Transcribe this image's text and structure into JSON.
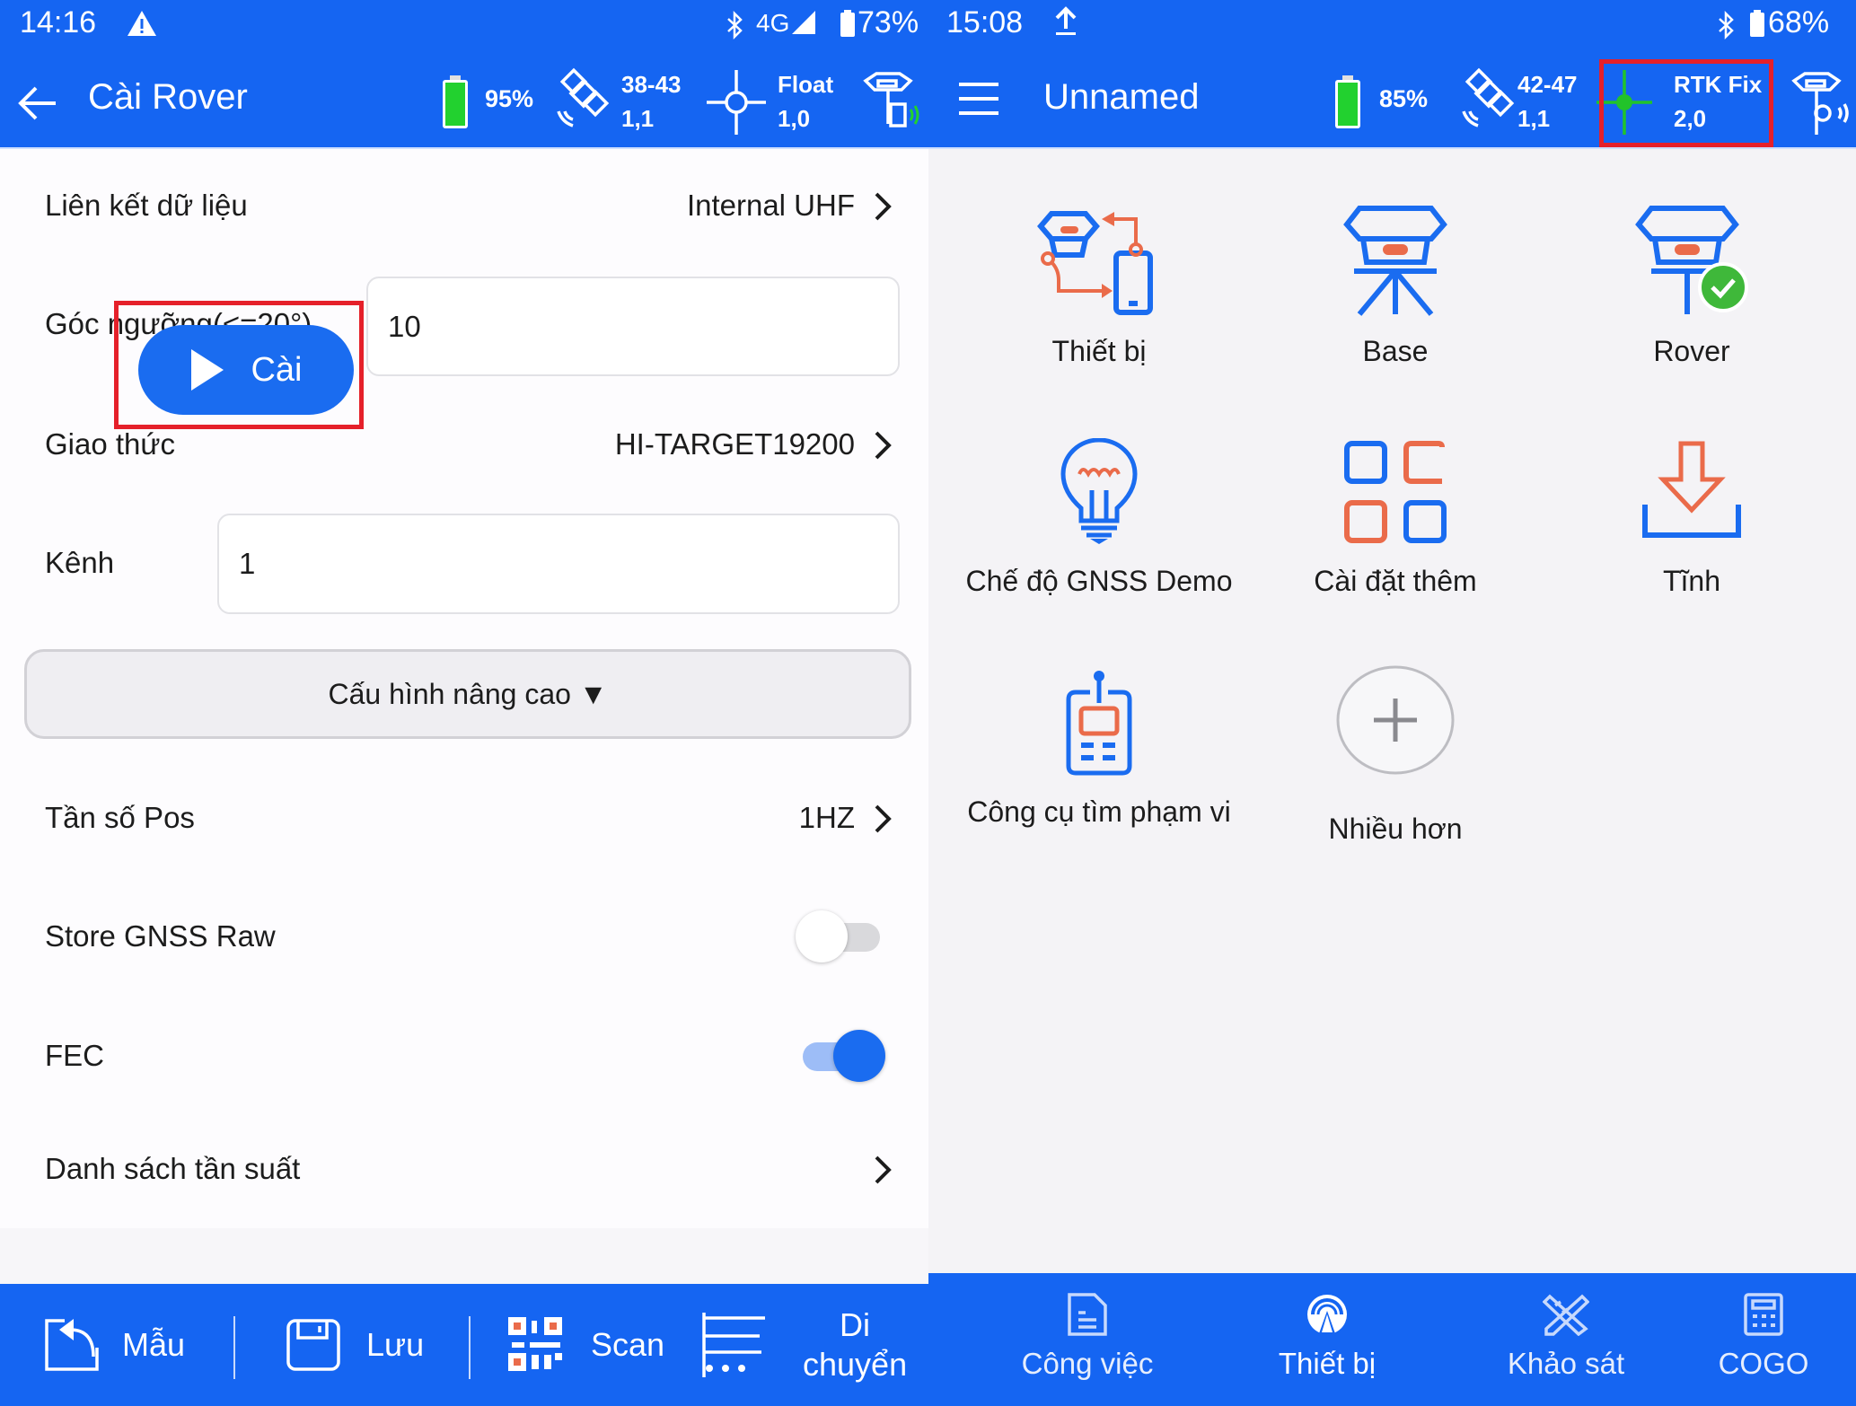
{
  "left": {
    "status_bar": {
      "time": "14:16",
      "network": "4G",
      "battery": "73%"
    },
    "app_bar": {
      "title": "Cài Rover",
      "receiver_battery": "95%",
      "satellites_line1": "38-43",
      "satellites_line2": "1,1",
      "solution_status": "Float",
      "solution_line2": "1,0"
    },
    "rows": {
      "data_link": {
        "label": "Liên kết dữ liệu",
        "value": "Internal UHF"
      },
      "elevation_mask": {
        "label": "Góc ngưỡng(<=20°)",
        "value": "10"
      },
      "protocol": {
        "label": "Giao thức",
        "value": "HI-TARGET19200"
      },
      "channel": {
        "label": "Kênh",
        "value": "1"
      },
      "advanced": {
        "label": "Cấu hình nâng cao ▼"
      },
      "pos_frequency": {
        "label": "Tần số Pos",
        "value": "1HZ"
      },
      "store_raw": {
        "label": "Store GNSS Raw",
        "enabled": false
      },
      "fec": {
        "label": "FEC",
        "enabled": true
      },
      "frequency_list": {
        "label": "Danh sách tần suất"
      }
    },
    "overlay_button": {
      "label": "Cài"
    },
    "bottom_bar": {
      "template": "Mẫu",
      "save": "Lưu",
      "scan": "Scan",
      "move_line1": "Di",
      "move_line2": "chuyển"
    }
  },
  "right": {
    "status_bar": {
      "time": "15:08",
      "battery": "68%"
    },
    "app_bar": {
      "title": "Unnamed",
      "receiver_battery": "85%",
      "satellites_line1": "42-47",
      "satellites_line2": "1,1",
      "solution_status": "RTK Fix",
      "solution_line2": "2,0"
    },
    "tiles": [
      {
        "label": "Thiết bị",
        "icon": "device-connect-icon"
      },
      {
        "label": "Base",
        "icon": "base-tripod-icon"
      },
      {
        "label": "Rover",
        "icon": "rover-check-icon"
      },
      {
        "label": "Chế độ GNSS Demo",
        "icon": "lightbulb-icon"
      },
      {
        "label": "Cài đặt thêm",
        "icon": "grid-apps-icon"
      },
      {
        "label": "Tĩnh",
        "icon": "download-icon"
      },
      {
        "label": "Công cụ tìm phạm vi",
        "icon": "radio-handset-icon"
      },
      {
        "label": "Nhiều hơn",
        "icon": "plus-circle-icon"
      }
    ],
    "bottom_nav": [
      {
        "label": "Công việc",
        "icon": "document-icon",
        "active": false
      },
      {
        "label": "Thiết bị",
        "icon": "antenna-icon",
        "active": true
      },
      {
        "label": "Khảo sát",
        "icon": "ruler-pencil-icon",
        "active": false
      },
      {
        "label": "COGO",
        "icon": "calculator-icon",
        "active": false
      }
    ]
  },
  "colors": {
    "primary": "#1565f2",
    "accent_orange": "#ea6b4a",
    "highlight_red": "#e5202a",
    "fix_green": "#22c32a",
    "battery_green": "#22d12f"
  }
}
